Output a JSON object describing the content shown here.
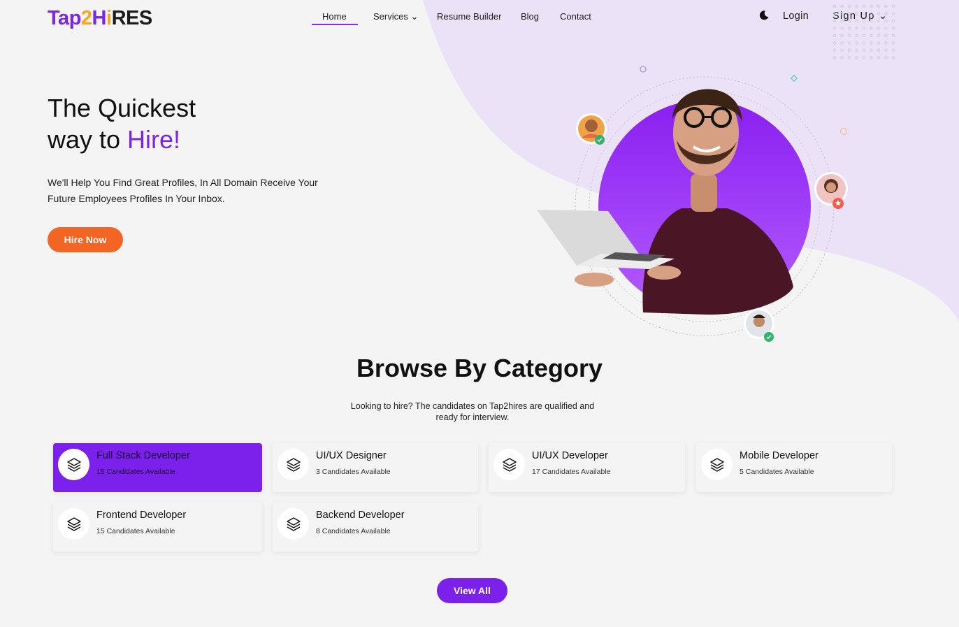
{
  "brand": {
    "part1": "Tap",
    "part2": "2",
    "part3": "H",
    "part4": "i",
    "part5": "RES"
  },
  "nav": {
    "items": [
      {
        "label": "Home"
      },
      {
        "label": "Services ⌄"
      },
      {
        "label": "Resume Builder"
      },
      {
        "label": "Blog"
      },
      {
        "label": "Contact"
      }
    ],
    "login": "Login",
    "signup": "Sign Up ⌄"
  },
  "hero": {
    "title_line1": "The Quickest",
    "title_line2_prefix": "way to ",
    "title_line2_accent": "Hire!",
    "subtitle": "We'll Help You Find Great Profiles, In All Domain Receive Your Future Employees Profiles In Your Inbox.",
    "cta": "Hire Now"
  },
  "category": {
    "title": "Browse By Category",
    "subtitle": "Looking to hire? The candidates on Tap2hires are qualified and ready for interview.",
    "cards": [
      {
        "title": "Full Stack Developer",
        "count": "15 Candidates Available",
        "active": true
      },
      {
        "title": "UI/UX Designer",
        "count": "3 Candidates Available",
        "active": false
      },
      {
        "title": "UI/UX Developer",
        "count": "17 Candidates Available",
        "active": false
      },
      {
        "title": "Mobile Developer",
        "count": "5 Candidates Available",
        "active": false
      },
      {
        "title": "Frontend Developer",
        "count": "15 Candidates Available",
        "active": false
      },
      {
        "title": "Backend Developer",
        "count": "8 Candidates Available",
        "active": false
      }
    ],
    "view_all": "View All"
  },
  "colors": {
    "primary": "#7b24e8",
    "accent": "#f26522",
    "blob": "#ebe2f7"
  },
  "icons": {
    "theme": "moon-icon",
    "category": "layers-icon"
  }
}
